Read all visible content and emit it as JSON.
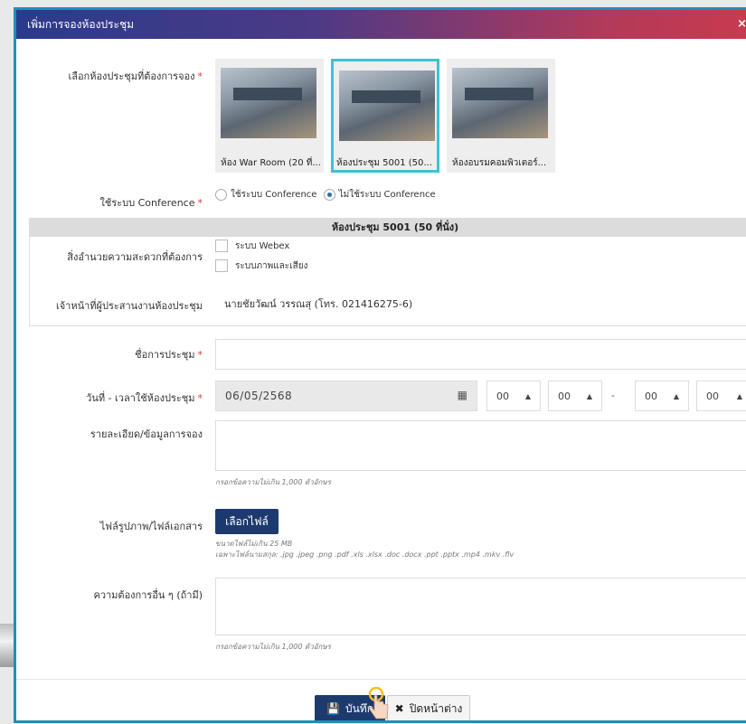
{
  "modal": {
    "title": "เพิ่มการจองห้องประชุม",
    "close_label": "×"
  },
  "form": {
    "room_label": "เลือกห้องประชุมที่ต้องการจอง",
    "rooms": [
      {
        "caption": "ห้อง War Room (20 ที่..."
      },
      {
        "caption": "ห้องประชุม 5001 (50..."
      },
      {
        "caption": "ห้องอบรมคอมพิวเตอร์..."
      }
    ],
    "conference_label": "ใช้ระบบ Conference",
    "conference_options": [
      "ใช้ระบบ Conference",
      "ไม่ใช้ระบบ Conference"
    ],
    "selected_room_header": "ห้องประชุม 5001 (50 ที่นั่ง)",
    "facilities_label": "สิ่งอำนวยความสะดวกที่ต้องการ",
    "facilities": [
      "ระบบ Webex",
      "ระบบภาพและเสียง"
    ],
    "staff_label": "เจ้าหน้าที่ผู้ประสานงานห้องประชุม",
    "staff_value": "นายชัยวัฒน์ วรรณสุ (โทร. 021416275-6)",
    "meeting_name_label": "ชื่อการประชุม",
    "datetime_label": "วันที่ - เวลาใช้ห้องประชุม",
    "date_value": "06/05/2568",
    "time_values": [
      "00",
      "00",
      "00",
      "00"
    ],
    "time_separator": "-",
    "details_label": "รายละเอียด/ข้อมูลการจอง",
    "details_hint": "กรอกข้อความไม่เกิน 1,000 ตัวอักษร",
    "file_label": "ไฟล์รูปภาพ/ไฟล์เอกสาร",
    "file_button": "เลือกไฟล์",
    "file_hint_size": "ขนาดไฟล์ไม่เกิน 25 MB",
    "file_hint_types": "เฉพาะไฟล์นามสกุล: .jpg .jpeg .png .pdf .xls .xlsx .doc .docx .ppt .pptx .mp4 .mkv .flv",
    "other_label": "ความต้องการอื่น ๆ (ถ้ามี)",
    "other_hint": "กรอกข้อความไม่เกิน 1,000 ตัวอักษร",
    "required_mark": "*"
  },
  "footer": {
    "save_label": "บันทึก",
    "close_label": "ปิดหน้าต่าง"
  },
  "colors": {
    "accent": "#1d3a6e",
    "selected_border": "#3cc3d0",
    "required": "#d9343e"
  }
}
